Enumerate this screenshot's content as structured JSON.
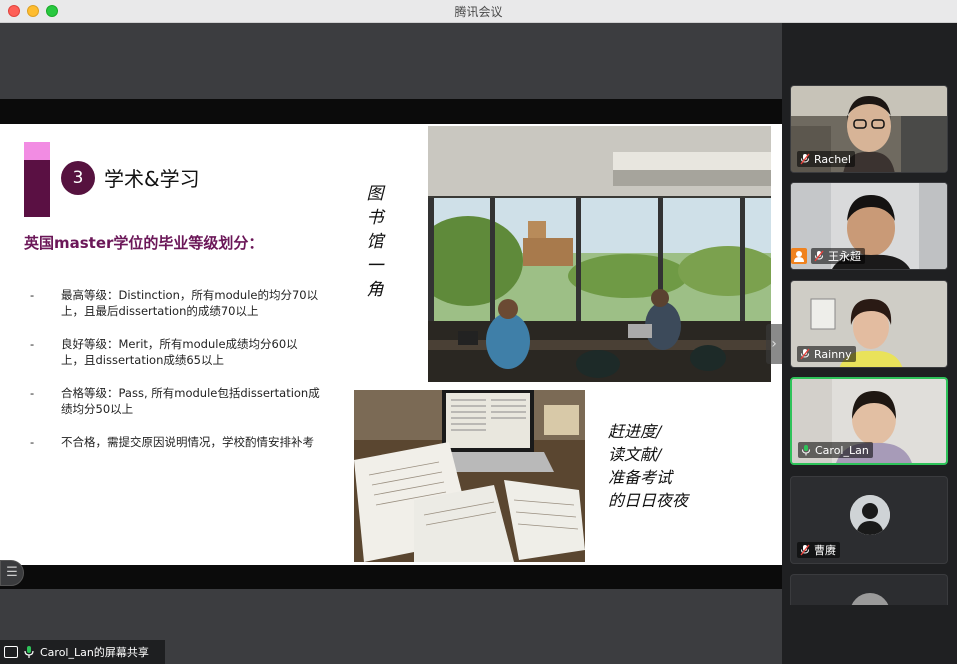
{
  "window": {
    "title": "腾讯会议"
  },
  "slide": {
    "section_number": "3",
    "section_title": "学术&学习",
    "subtitle": "英国master学位的毕业等级划分：",
    "bullets": [
      {
        "dash": "-",
        "text": "最高等级：Distinction，所有module的均分70以上，且最后dissertation的成绩70以上"
      },
      {
        "dash": "-",
        "text": "良好等级：Merit，所有module成绩均分60以上，且dissertation成绩65以上"
      },
      {
        "dash": "-",
        "text": "合格等级：Pass, 所有module包括dissertation成绩均分50以上"
      },
      {
        "dash": "-",
        "text": "不合格，需提交原因说明情况，学校酌情安排补考"
      }
    ],
    "vertical_caption": [
      "图",
      "书",
      "馆",
      "一",
      "角"
    ],
    "caption_lines": [
      "赶进度/",
      "读文献/",
      "准备考试",
      "的日日夜夜"
    ]
  },
  "share_bar": {
    "label": "Carol_Lan的屏幕共享"
  },
  "participants": [
    {
      "name": "Rachel",
      "active": false
    },
    {
      "name": "王永超",
      "active": false
    },
    {
      "name": "Rainny",
      "active": false
    },
    {
      "name": "Carol_Lan",
      "active": true
    },
    {
      "name": "曹赓",
      "active": false
    }
  ],
  "colors": {
    "accent_purple": "#5a1043",
    "accent_pink": "#f28ce3",
    "subtitle": "#6b1758",
    "active_speaker": "#2ec35a"
  },
  "icons": [
    "mic-muted-icon",
    "mic-on-icon",
    "screen-share-icon",
    "host-icon",
    "chevron-right-icon",
    "list-icon"
  ]
}
